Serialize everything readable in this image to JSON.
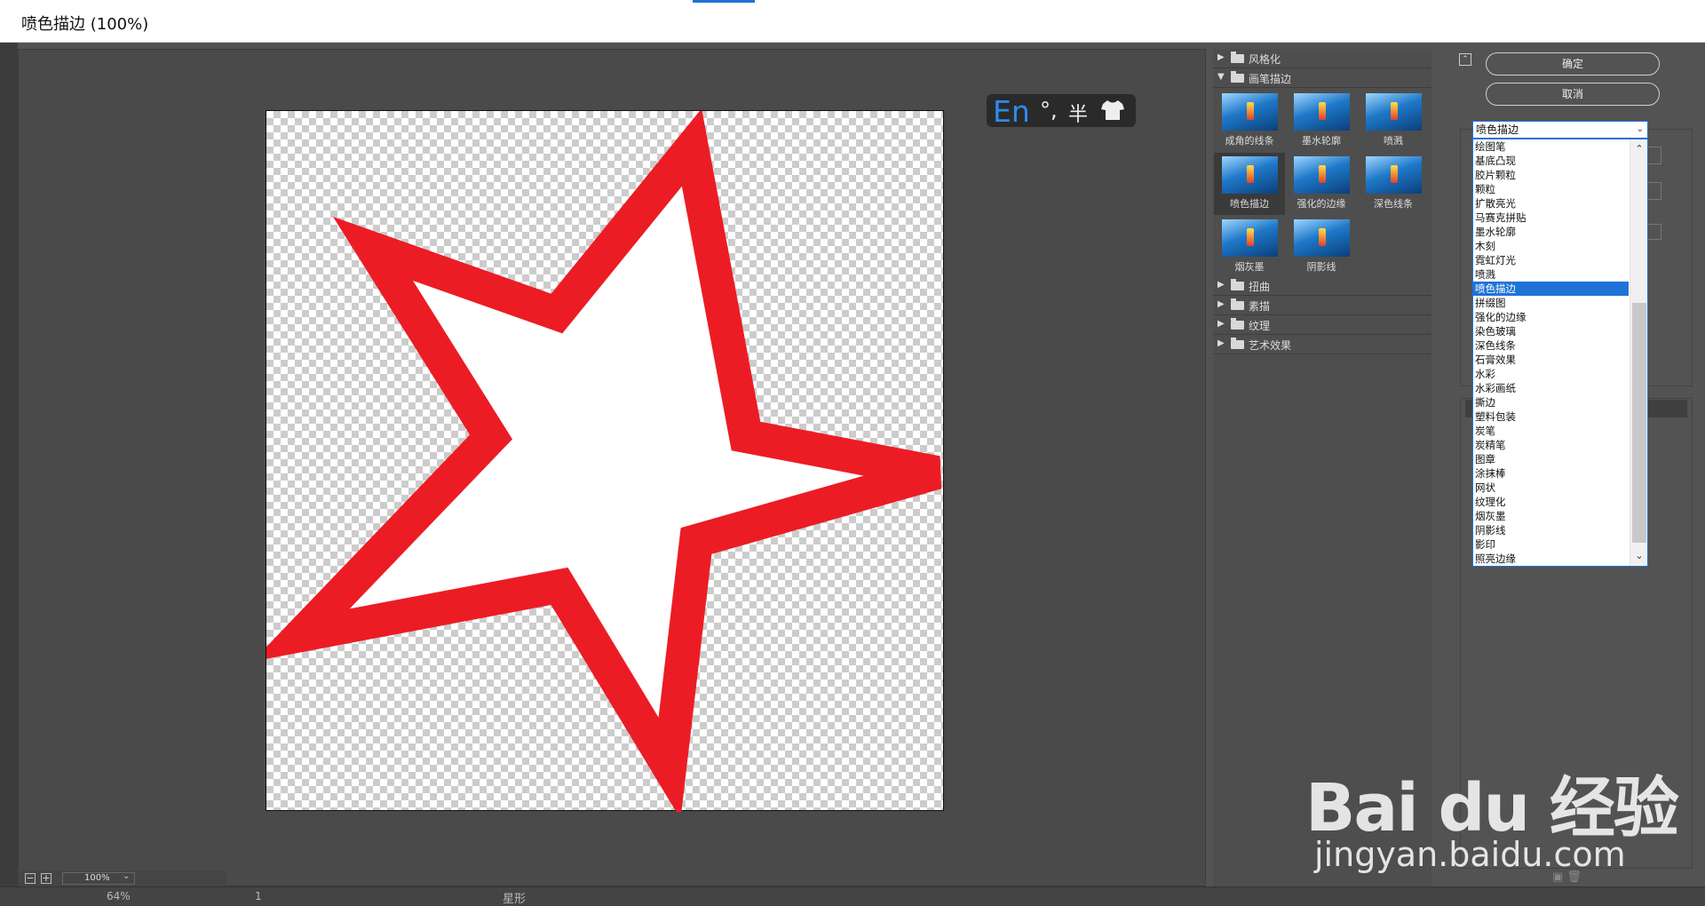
{
  "window": {
    "title": "喷色描边 (100%)"
  },
  "ime": {
    "lang": "En",
    "punct": "°,",
    "width": "半"
  },
  "zoom": {
    "value": "100%",
    "minus": "−",
    "plus": "+"
  },
  "status": {
    "zoom": "64%",
    "page": "1",
    "shape": "星形"
  },
  "categories": {
    "stylize": "风格化",
    "brush_strokes": "画笔描边",
    "distort": "扭曲",
    "sketch": "素描",
    "texture": "纹理",
    "artistic": "艺术效果"
  },
  "thumbs": [
    {
      "label": "成角的线条"
    },
    {
      "label": "墨水轮廓"
    },
    {
      "label": "喷溅"
    },
    {
      "label": "喷色描边"
    },
    {
      "label": "强化的边缘"
    },
    {
      "label": "深色线条"
    },
    {
      "label": "烟灰墨"
    },
    {
      "label": "阴影线"
    }
  ],
  "buttons": {
    "ok": "确定",
    "cancel": "取消"
  },
  "dropdown": {
    "selected": "喷色描边",
    "options": [
      "绘图笔",
      "基底凸现",
      "胶片颗粒",
      "颗粒",
      "扩散亮光",
      "马赛克拼贴",
      "墨水轮廓",
      "木刻",
      "霓虹灯光",
      "喷溅",
      "喷色描边",
      "拼缀图",
      "强化的边缘",
      "染色玻璃",
      "深色线条",
      "石膏效果",
      "水彩",
      "水彩画纸",
      "撕边",
      "塑料包装",
      "炭笔",
      "炭精笔",
      "图章",
      "涂抹棒",
      "网状",
      "纹理化",
      "烟灰墨",
      "阴影线",
      "影印",
      "照亮边缘"
    ]
  },
  "watermark": {
    "brand": "Bai du 经验",
    "url": "jingyan.baidu.com"
  },
  "colors": {
    "star_stroke": "#ec1c24",
    "accent": "#1f73d6"
  }
}
